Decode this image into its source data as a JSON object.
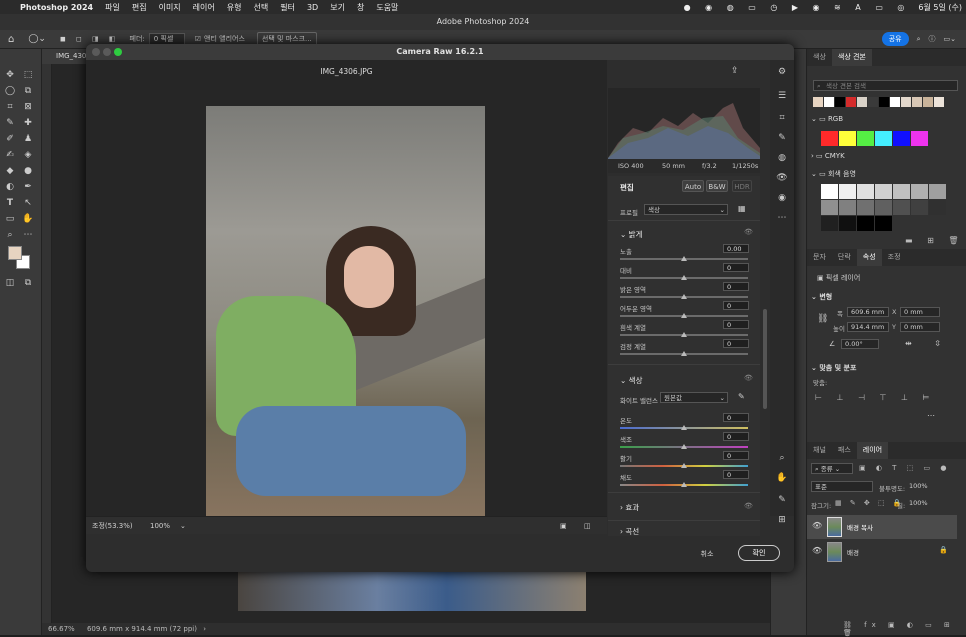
{
  "menubar": {
    "app": "Photoshop 2024",
    "items": [
      "파일",
      "편집",
      "이미지",
      "레이어",
      "유형",
      "선택",
      "필터",
      "3D",
      "보기",
      "창",
      "도움말"
    ],
    "clock": "6월 5일 (수)"
  },
  "window_title": "Adobe Photoshop 2024",
  "options": {
    "feather_label": "페더:",
    "feather_value": "0 픽셀",
    "antialias": "앤티 앨리어스",
    "select_mask": "선택 및 마스크...",
    "share": "공유"
  },
  "doc_tab": "IMG_430",
  "camera_raw": {
    "title": "Camera Raw 16.2.1",
    "filename": "IMG_4306.JPG",
    "exif": {
      "iso": "ISO 400",
      "focal": "50 mm",
      "aperture": "f/3.2",
      "shutter": "1/1250s"
    },
    "edit_label": "편집",
    "auto": "Auto",
    "bw": "B&W",
    "hdr": "HDR",
    "profile_label": "프로필",
    "profile_value": "색상",
    "light_section": "밝게",
    "sliders_light": [
      {
        "label": "노출",
        "value": "0.00",
        "pos": 0.5
      },
      {
        "label": "대비",
        "value": "0",
        "pos": 0.5
      },
      {
        "label": "밝은 영역",
        "value": "0",
        "pos": 0.5
      },
      {
        "label": "어두운 영역",
        "value": "0",
        "pos": 0.5
      },
      {
        "label": "흰색 계열",
        "value": "0",
        "pos": 0.5
      },
      {
        "label": "검정 계열",
        "value": "0",
        "pos": 0.5
      }
    ],
    "color_section": "색상",
    "wb_label": "화이트 밸런스",
    "wb_value": "원본값",
    "sliders_color": [
      {
        "label": "온도",
        "value": "0",
        "pos": 0.5
      },
      {
        "label": "색조",
        "value": "0",
        "pos": 0.5
      },
      {
        "label": "활기",
        "value": "0",
        "pos": 0.5
      },
      {
        "label": "채도",
        "value": "0",
        "pos": 0.5
      }
    ],
    "effects_section": "효과",
    "next_section": "곡선",
    "zoom_fit": "조정(53.3%)",
    "zoom_100": "100%",
    "cancel": "취소",
    "ok": "확인"
  },
  "status": {
    "zoom": "66.67%",
    "info": "609.6 mm x 914.4 mm (72 ppi)"
  },
  "swatches_panel": {
    "tabs": [
      "색상",
      "색상 견본"
    ],
    "search_placeholder": "색상 견본 검색",
    "groups": [
      "RGB",
      "CMYK",
      "회색 음영"
    ],
    "recent_colors": [
      "#e7d4c1",
      "#ffffff",
      "#000000",
      "#d42b2b",
      "#d9d2c8",
      "#3a3a3a",
      "#000000",
      "#ffffff",
      "#e2d7cb",
      "#d8c7b5",
      "#c9b39a",
      "#ece3d9"
    ],
    "rgb_colors": [
      "#ff2a2a",
      "#ffff3a",
      "#55ee44",
      "#44eeff",
      "#1010ff",
      "#ee33ee"
    ],
    "gray_colors": [
      "#ffffff",
      "#f0f0f0",
      "#e0e0e0",
      "#d0d0d0",
      "#c0c0c0",
      "#b0b0b0",
      "#a0a0a0",
      "#909090",
      "#808080",
      "#707070",
      "#606060",
      "#505050",
      "#404040",
      "#303030",
      "#202020",
      "#101010",
      "#000000",
      "#000000"
    ]
  },
  "properties_panel": {
    "tabs": [
      "문자",
      "단락",
      "속성",
      "조정"
    ],
    "layer_type": "픽셀 레이어",
    "transform": "변형",
    "w_label": "폭",
    "w": "609.6 mm",
    "h_label": "높이",
    "h": "914.4 mm",
    "x_label": "X",
    "x": "0 mm",
    "y_label": "Y",
    "y": "0 mm",
    "angle": "0.00°",
    "align_section": "맞춤 및 분포",
    "align_label": "맞춤:"
  },
  "layers_panel": {
    "tabs": [
      "채널",
      "패스",
      "레이어"
    ],
    "kind": "종류",
    "blend": "표준",
    "opacity_label": "불투명도:",
    "opacity": "100%",
    "lock_label": "잠그기:",
    "fill_label": "칠:",
    "fill": "100%",
    "layers": [
      {
        "name": "배경 복사",
        "selected": true
      },
      {
        "name": "배경",
        "selected": false
      }
    ]
  }
}
